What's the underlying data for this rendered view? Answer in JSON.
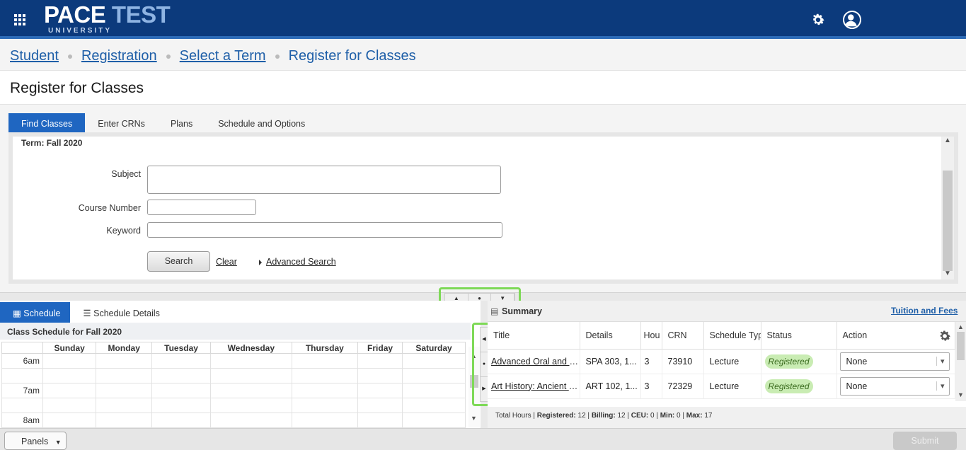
{
  "header": {
    "logo_main": "PACE",
    "logo_accent": "TEST",
    "logo_sub": "UNIVERSITY",
    "icons": [
      "apps-grid-icon",
      "gear-icon",
      "user-icon"
    ]
  },
  "breadcrumb": {
    "items": [
      "Student",
      "Registration",
      "Select a Term",
      "Register for Classes"
    ]
  },
  "page": {
    "title": "Register for Classes"
  },
  "tabs": [
    "Find Classes",
    "Enter CRNs",
    "Plans",
    "Schedule and Options"
  ],
  "find": {
    "term": "Term: Fall 2020",
    "subject_label": "Subject",
    "course_number_label": "Course Number",
    "keyword_label": "Keyword",
    "search_label": "Search",
    "clear_label": "Clear",
    "advanced_label": "Advanced Search"
  },
  "lower_tabs": [
    "Schedule",
    "Schedule Details"
  ],
  "calendar": {
    "title": "Class Schedule for Fall 2020",
    "days": [
      "Sunday",
      "Monday",
      "Tuesday",
      "Wednesday",
      "Thursday",
      "Friday",
      "Saturday"
    ],
    "hours": [
      "6am",
      "7am",
      "8am"
    ]
  },
  "summary": {
    "title": "Summary",
    "tuition_label": "Tuition and Fees",
    "columns": [
      "Title",
      "Details",
      "Hou",
      "CRN",
      "Schedule Typ",
      "Status",
      "Action"
    ],
    "rows": [
      {
        "title": "Advanced Oral and Written Spanish",
        "details": "SPA 303, 1...",
        "hours": "3",
        "crn": "73910",
        "type": "Lecture",
        "status": "Registered",
        "action": "None"
      },
      {
        "title": "Art History: Ancient to Medieval",
        "details": "ART 102, 1...",
        "hours": "3",
        "crn": "72329",
        "type": "Lecture",
        "status": "Registered",
        "action": "None"
      }
    ],
    "totals": {
      "prefix": "Total Hours |",
      "registered_label": "Registered:",
      "registered": "12",
      "billing_label": "Billing:",
      "billing": "12",
      "ceu_label": "CEU:",
      "ceu": "0",
      "min_label": "Min:",
      "min": "0",
      "max_label": "Max:",
      "max": "17"
    }
  },
  "footer": {
    "panels_label": "Panels",
    "submit_label": "Submit"
  },
  "colors": {
    "header_bg": "#0c3a7c",
    "accent": "#1f66c1",
    "highlight": "#7ed957",
    "registered_badge": "#c9ecb3"
  }
}
